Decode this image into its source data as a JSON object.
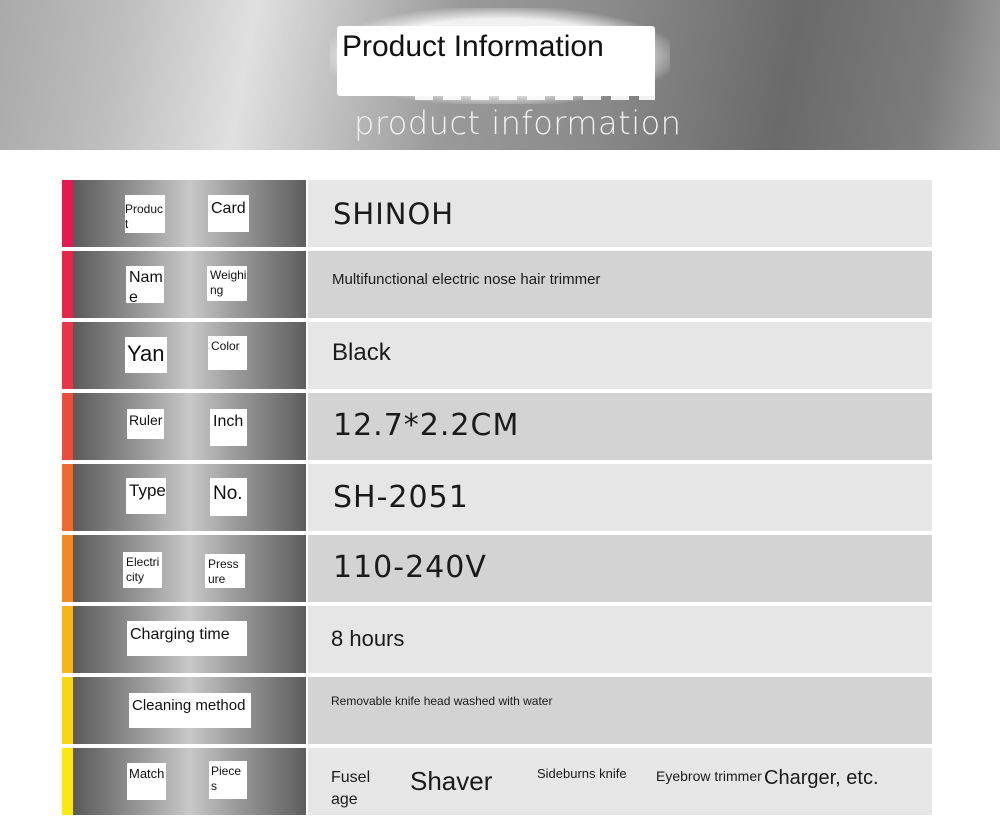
{
  "header": {
    "title": "Product Information",
    "subtitle": "product information"
  },
  "rows": [
    {
      "label_left": "Product",
      "label_right": "Card",
      "value": "SHINOH",
      "accent": "#e8174f"
    },
    {
      "label_left": "Name",
      "label_right": "Weighing",
      "value": "Multifunctional electric nose hair trimmer",
      "accent": "#e9234a"
    },
    {
      "label_left": "Yan",
      "label_right": "Color",
      "value": "Black",
      "accent": "#ea3344"
    },
    {
      "label_left": "Ruler",
      "label_right": "Inch",
      "value": "12.7*2.2CM",
      "accent": "#ee4b38"
    },
    {
      "label_left": "Type",
      "label_right": "No.",
      "value": "SH-2051",
      "accent": "#f16a2a"
    },
    {
      "label_left": "Electricity",
      "label_right": "Pressure",
      "value": "110-240V",
      "accent": "#f4891f"
    },
    {
      "label": "Charging time",
      "value": "8 hours",
      "accent": "#f8b514"
    },
    {
      "label": "Cleaning method",
      "value": "Removable knife head washed with water",
      "accent": "#fbd60c"
    },
    {
      "label_left": "Match",
      "label_right": "Pieces",
      "accent": "#fde905",
      "items": [
        "Fuselage",
        "Shaver",
        "Sideburns knife",
        "Eyebrow trimmer",
        "Charger, etc."
      ]
    }
  ]
}
